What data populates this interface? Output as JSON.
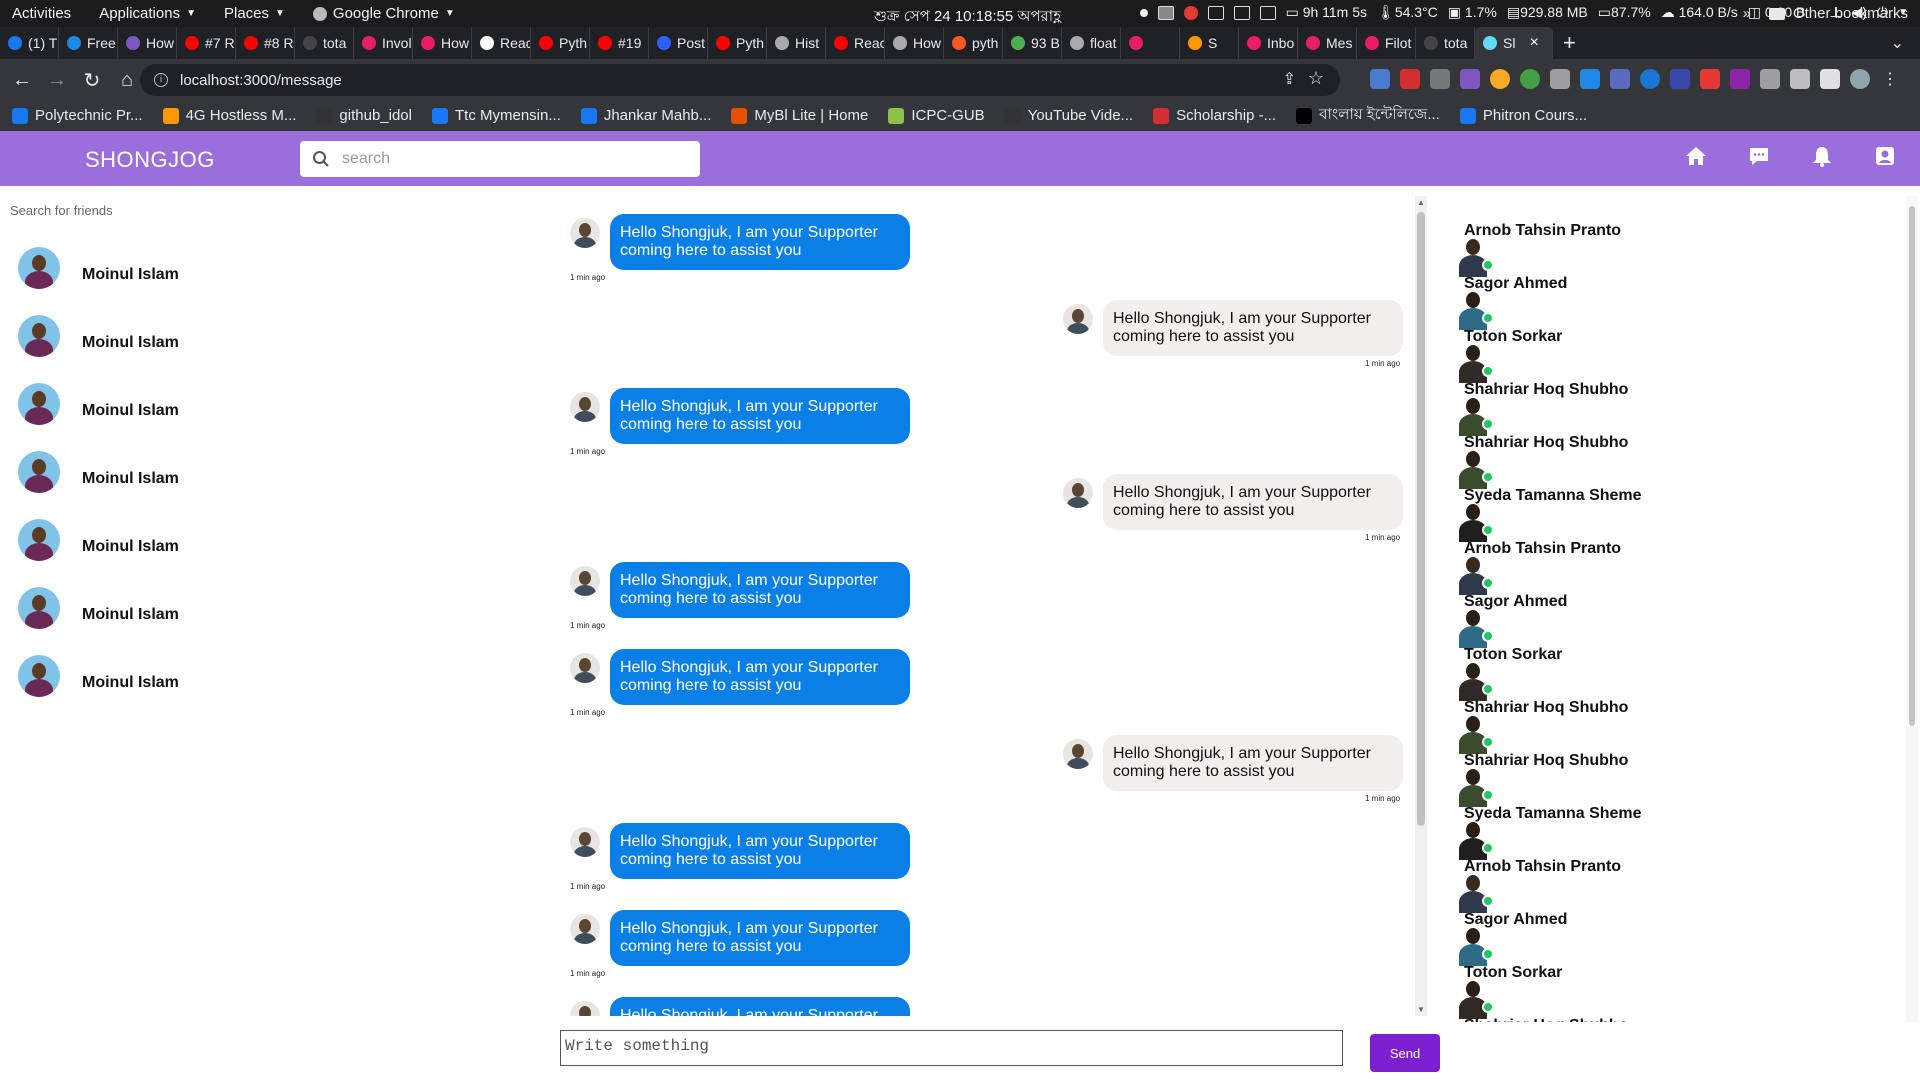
{
  "system_bar": {
    "activities": "Activities",
    "applications": "Applications",
    "places": "Places",
    "active_app": "Google Chrome",
    "clock": "শুক্র সেপ 24  10:18:55 অপরাহ্ণ",
    "uptime": "9h 11m 5s",
    "temperature": "54.3°C",
    "cpu": "1.7%",
    "memory": "929.88 MB",
    "battery": "87.7%",
    "net_up": "164.0 B/s",
    "net_down": "0.00 B"
  },
  "tabs": [
    {
      "label": "(1) T",
      "color": "#1877f2"
    },
    {
      "label": "Free",
      "color": "#1e88e5"
    },
    {
      "label": "How",
      "color": "#7e57c2"
    },
    {
      "label": "#7 R",
      "color": "#ff0000"
    },
    {
      "label": "#8 R",
      "color": "#ff0000"
    },
    {
      "label": "tota",
      "color": "#444"
    },
    {
      "label": "Invol",
      "color": "#e91e63"
    },
    {
      "label": "How",
      "color": "#e91e63"
    },
    {
      "label": "Reac",
      "color": "#fff"
    },
    {
      "label": "Pyth",
      "color": "#ff0000"
    },
    {
      "label": "#19",
      "color": "#ff0000"
    },
    {
      "label": "Post",
      "color": "#2962ff"
    },
    {
      "label": "Pyth",
      "color": "#ff0000"
    },
    {
      "label": "Hist",
      "color": "#aaa"
    },
    {
      "label": "Reac",
      "color": "#ff0000"
    },
    {
      "label": "How",
      "color": "#aaa"
    },
    {
      "label": "pyth",
      "color": "#ff5722"
    },
    {
      "label": "93 B",
      "color": "#4caf50"
    },
    {
      "label": "float",
      "color": "#aaa"
    },
    {
      "label": "",
      "color": "#e91e63"
    },
    {
      "label": "S",
      "color": "#ff9800"
    },
    {
      "label": "Inbo",
      "color": "#e91e63"
    },
    {
      "label": "Mes",
      "color": "#e91e63"
    },
    {
      "label": "Filot",
      "color": "#e91e63"
    },
    {
      "label": "tota",
      "color": "#444"
    },
    {
      "label": "Sl",
      "color": "#61dafb",
      "active": true
    }
  ],
  "address": {
    "url": "localhost:3000/message"
  },
  "bookmarks": [
    {
      "label": "Polytechnic Pr...",
      "color": "#1877f2"
    },
    {
      "label": "4G Hostless M...",
      "color": "#ff9800"
    },
    {
      "label": "github_idol",
      "color": "#333"
    },
    {
      "label": "Ttc Mymensin...",
      "color": "#1877f2"
    },
    {
      "label": "Jhankar Mahb...",
      "color": "#1877f2"
    },
    {
      "label": "MyBl Lite | Home",
      "color": "#e65100"
    },
    {
      "label": "ICPC-GUB",
      "color": "#8bc34a"
    },
    {
      "label": "YouTube Vide...",
      "color": "#333"
    },
    {
      "label": "Scholarship -...",
      "color": "#d32f2f"
    },
    {
      "label": "বাংলায় ইন্টেলিজে...",
      "color": "#000"
    },
    {
      "label": "Phitron Cours...",
      "color": "#1877f2"
    }
  ],
  "other_bookmarks": "Other bookmarks",
  "app": {
    "brand": "SHONGJOG",
    "search_placeholder": "search",
    "friend_search_placeholder": "Search for friends",
    "accent": "#9a6fdb"
  },
  "friends": [
    {
      "name": "Moinul Islam"
    },
    {
      "name": "Moinul Islam"
    },
    {
      "name": "Moinul Islam"
    },
    {
      "name": "Moinul Islam"
    },
    {
      "name": "Moinul Islam"
    },
    {
      "name": "Moinul Islam"
    },
    {
      "name": "Moinul Islam"
    }
  ],
  "messages": [
    {
      "side": "out",
      "text": "Hello Shongjuk, I am your Supporter coming here to assist you",
      "time": "1 min ago"
    },
    {
      "side": "in",
      "text": "Hello Shongjuk, I am your Supporter coming here to assist you",
      "time": "1 min ago"
    },
    {
      "side": "out",
      "text": "Hello Shongjuk, I am your Supporter coming here to assist you",
      "time": "1 min ago"
    },
    {
      "side": "in",
      "text": "Hello Shongjuk, I am your Supporter coming here to assist you",
      "time": "1 min ago"
    },
    {
      "side": "out",
      "text": "Hello Shongjuk, I am your Supporter coming here to assist you",
      "time": "1 min ago"
    },
    {
      "side": "out",
      "text": "Hello Shongjuk, I am your Supporter coming here to assist you",
      "time": "1 min ago"
    },
    {
      "side": "in",
      "text": "Hello Shongjuk, I am your Supporter coming here to assist you",
      "time": "1 min ago"
    },
    {
      "side": "out",
      "text": "Hello Shongjuk, I am your Supporter coming here to assist you",
      "time": "1 min ago"
    },
    {
      "side": "out",
      "text": "Hello Shongjuk, I am your Supporter coming here to assist you",
      "time": "1 min ago"
    },
    {
      "side": "out",
      "text": "Hello Shongjuk, I am your Supporter coming here to assist you",
      "time": ""
    }
  ],
  "composer": {
    "placeholder": "Write something",
    "send_label": "Send"
  },
  "contacts": [
    {
      "name": "Arnob Tahsin Pranto"
    },
    {
      "name": "Sagor Ahmed"
    },
    {
      "name": "Toton Sorkar"
    },
    {
      "name": "Shahriar Hoq Shubho"
    },
    {
      "name": "Shahriar Hoq Shubho"
    },
    {
      "name": "Syeda Tamanna Sheme"
    },
    {
      "name": "Arnob Tahsin Pranto"
    },
    {
      "name": "Sagor Ahmed"
    },
    {
      "name": "Toton Sorkar"
    },
    {
      "name": "Shahriar Hoq Shubho"
    },
    {
      "name": "Shahriar Hoq Shubho"
    },
    {
      "name": "Syeda Tamanna Sheme"
    },
    {
      "name": "Arnob Tahsin Pranto"
    },
    {
      "name": "Sagor Ahmed"
    },
    {
      "name": "Toton Sorkar"
    },
    {
      "name": "Shahriar Hoq Shubho"
    }
  ]
}
